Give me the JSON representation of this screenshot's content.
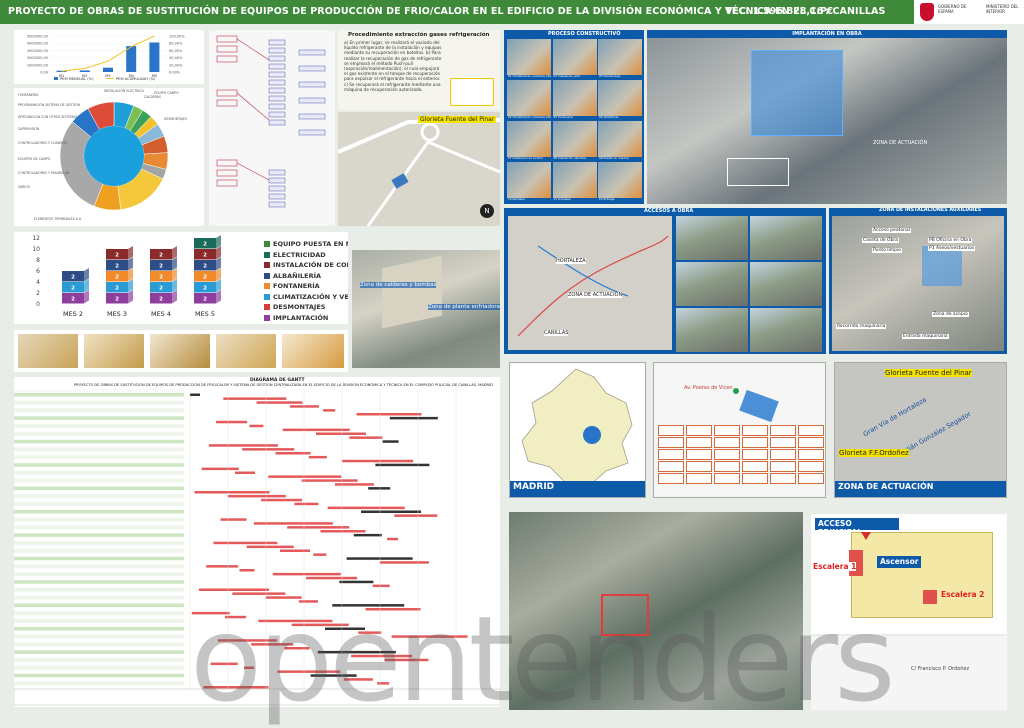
{
  "header": {
    "title": "PROYECTO DE OBRAS DE SUSTITUCIÓN DE EQUIPOS DE PRODUCCIÓN DE FRIO/CALOR EN EL EDIFICIO DE LA DIVISIÓN ECONÓMICA Y TÉCNICA EN EL C.P. CANILLAS",
    "vec": "VEC: 1.596.828,16 €",
    "colors": {
      "header_bg": "#3f8a3a",
      "accent_blue": "#0d5aa8"
    }
  },
  "logo": {
    "government": "GOBIERNO DE ESPAÑA",
    "ministry": "MINISTERIO DEL INTERIOR"
  },
  "chart_data": [
    {
      "type": "bar",
      "categories": [
        "M1",
        "M2",
        "M3",
        "M4",
        "M5"
      ],
      "series": [
        {
          "name": "PEM MENSUAL (%)",
          "values": [
            180000,
            220000,
            600000,
            3600000,
            4100000
          ]
        },
        {
          "name": "PEM ACUMULADO (%)",
          "values": [
            2,
            10,
            30,
            70,
            100
          ]
        }
      ],
      "yticks_left": [
        "0,00",
        "1000000,00",
        "2000000,00",
        "3000000,00",
        "4000000,00",
        "5000000,00"
      ],
      "yticks_right": [
        "0,00%",
        "20,00%",
        "40,00%",
        "60,00%",
        "80,00%",
        "100,00%"
      ],
      "colors": {
        "bars": "#2a74c8",
        "line": "#f3c325"
      }
    },
    {
      "type": "bar",
      "stacked": true,
      "categories": [
        "MES 2",
        "MES 3",
        "MES 4",
        "MES 5"
      ],
      "yticks": [
        "0",
        "2",
        "4",
        "6",
        "8",
        "10",
        "12"
      ],
      "series": [
        {
          "name": "IMPLANTACIÓN",
          "values": [
            2,
            2,
            2,
            2
          ],
          "color": "#8e3f9c"
        },
        {
          "name": "DESMONTAJES",
          "values": [
            0,
            0,
            0,
            0
          ],
          "color": "#d83a3a"
        },
        {
          "name": "CLIMATIZACIÓN Y VENTILACIÓN",
          "values": [
            2,
            2,
            2,
            2
          ],
          "color": "#2b9bd6"
        },
        {
          "name": "FONTANERÍA",
          "values": [
            0,
            2,
            2,
            2
          ],
          "color": "#f08a2a"
        },
        {
          "name": "ALBAÑILERÍA",
          "values": [
            2,
            2,
            2,
            2
          ],
          "color": "#2e4c86"
        },
        {
          "name": "INSTALACIÓN DE CONTROL",
          "values": [
            0,
            2,
            2,
            2
          ],
          "color": "#8a2a2a"
        },
        {
          "name": "ELECTRICIDAD",
          "values": [
            0,
            0,
            0,
            2
          ],
          "color": "#1a6b5a"
        },
        {
          "name": "EQUIPO PUESTA EN MARCHA",
          "values": [
            0,
            0,
            0,
            0
          ],
          "color": "#3c8a3a"
        }
      ],
      "legend": [
        "EQUIPO PUESTA EN MARCHA",
        "ELECTRICIDAD",
        "INSTALACIÓN DE CONTROL",
        "ALBAÑILERÍA",
        "FONTANERÍA",
        "CLIMATIZACIÓN Y VENTILACIÓN",
        "DESMONTAJES",
        "IMPLANTACIÓN"
      ]
    },
    {
      "type": "pie",
      "labels": [
        "FONTANERÍA",
        "PROGRAMACIÓN SISTEMA DE GESTIÓN",
        "INTEGRACIÓN CON OTROS SISTEMAS",
        "SUPERVISIÓN",
        "CONTROLADORES Y CUADROS",
        "EQUIPOS DE CAMPO",
        "CONTROLADORES Y PASARELAS",
        "VARIOS",
        "ELEMENTOS TERMINALES A A",
        "CALDERAS",
        "DESMONTAJES",
        "EQUIPO CAMPO",
        "INSTALACIÓN ELÉCTRICA"
      ],
      "values": [
        6,
        3,
        3,
        3,
        4,
        5,
        5,
        3,
        16,
        8,
        30,
        6,
        8
      ]
    }
  ],
  "texts": {
    "recovery_title": "Procedimiento extracción gases refrigeración",
    "recovery_body": "a) En primer lugar, se realizará el vaciado del líquido refrigerante de la instalación y equipos mediante su recuperación en botellas.  b) Para realizar la recuperación de gas de refrigerante se empleará el método Push-pull (aspiración/realimentación), el cual empujará el gas existente en el tanque de recuperación para expulsar el refrigerante hacia el exterior.  c) Se recuperará el refrigerante mediante una máquina de recuperación autorizada.",
    "glorieta_map_label": "Glorieta Fuente del Pinar",
    "caldera_label": "Zona de calderas y bombas",
    "planta_label": "Zona de planta enfriadora",
    "proceso_title": "PROCESO CONSTRUCTIVO",
    "implantacion_title": "IMPLANTACIÓN EN OBRA",
    "zona_actuacion": "ZONA DE ACTUACIÓN",
    "accesos_title": "ACCESOS A OBRA",
    "auxiliares_title": "ZONA DE INSTALACIONES AUXILIARES",
    "hortaleza": "HORTALEZA",
    "canillas": "CANILLAS",
    "aux_labels": [
      "Acceso peatonal",
      "Caseta de Obra",
      "Punto limpio",
      "PB Oficina en Obra",
      "P1 Aseos/vestuarios",
      "Zona de acopio",
      "Recorrido maquinaria",
      "Entrada maquinaria"
    ],
    "proceso_steps": [
      "01 Climatización unidades interiores",
      "02 Instalación split",
      "03 Desmontaje",
      "04 Climatización unidades exteriores",
      "05 Fontanería",
      "06 Albañilería",
      "07 Instalación de control",
      "08 Instalación eléctrica",
      "09 Puesta en marcha",
      "10 Remates",
      "11 Limpieza",
      "12 Entrega"
    ],
    "madrid_label": "MADRID",
    "zona_actuacion2": "ZONA DE ACTUACIÓN",
    "gran_via": "Gran Vía de Hortaleza",
    "julian": "Julián González Segador",
    "glorieta_pinar": "Glorieta Fuente del Pinar",
    "glorieta_ordonez": "Glorieta F.F.Ordoñez",
    "acceso_principal": "ACCESO PRINCIPAL",
    "ascensor": "Ascensor",
    "escalera1": "Escalera 1",
    "escalera2": "Escalera 2",
    "gantt_title": "DIAGRAMA DE GANTT",
    "gantt_subtitle": "PROYECTO DE OBRAS DE SUSTITUCIÓN DE EQUIPOS DE PRODUCCIÓN DE FRIO/CALOR Y SISTEMA DE GESTIÓN CENTRALIZADA EN EL EDIFICIO DE LA DIVISIÓN ECONÓMICA Y TÉCNICA EN EL COMPLEJO POLICIAL DE CANILLAS, MADRID",
    "watermark": "opentenders",
    "street_label": "Av. Poetas de Vicen",
    "street_label2": "C/ Francisco P. Ordoñez"
  }
}
